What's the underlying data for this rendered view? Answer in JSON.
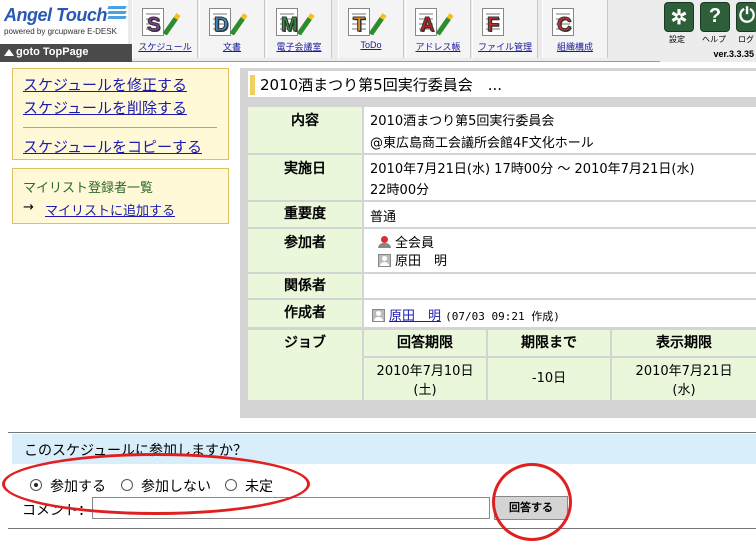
{
  "header": {
    "logo": "Angel Touch",
    "logo_sub": "powered by grcupware E-DESK",
    "goto_prefix": "goto",
    "goto_page": "TopPage",
    "nav": [
      {
        "label": "スケジュール",
        "letter": "S",
        "color": "#8a3aa8"
      },
      {
        "label": "文書",
        "letter": "D",
        "color": "#3a8ac0"
      },
      {
        "label": "電子会議室",
        "letter": "M",
        "color": "#2a9a3a"
      },
      {
        "label": "ToDo",
        "letter": "T",
        "color": "#e89020"
      },
      {
        "label": "アドレス帳",
        "letter": "A",
        "color": "#c02020"
      },
      {
        "label": "ファイル管理",
        "letter": "F",
        "color": "#c03030"
      },
      {
        "label": "組織構成",
        "letter": "C",
        "color": "#c03030"
      }
    ],
    "tools": {
      "settings": "設定",
      "help": "ヘルプ",
      "logout": "ログ"
    },
    "version": "ver.3.3.35"
  },
  "menu": {
    "edit": "スケジュールを修正する",
    "delete": "スケジュールを削除する",
    "copy": "スケジュールをコピーする",
    "mylist_title": "マイリスト登録者一覧",
    "mylist_arrow": "→",
    "mylist_add": "マイリストに追加する"
  },
  "schedule": {
    "title": "2010酒まつり第5回実行委員会　...",
    "labels": {
      "content": "内容",
      "datetime": "実施日",
      "importance": "重要度",
      "participants": "参加者",
      "related": "関係者",
      "creator": "作成者",
      "job": "ジョブ"
    },
    "content_line1": "2010酒まつり第5回実行委員会",
    "content_line2": "@東広島商工会議所会館4F文化ホール",
    "datetime_line1": "2010年7月21日(水) 17時00分 ～ 2010年7月21日(水)",
    "datetime_line2": "22時00分",
    "importance": "普通",
    "participant_group": "全会員",
    "participant_user": "原田　明",
    "related": "",
    "creator_name": "原田　明",
    "creator_meta": "(07/03 09:21 作成)",
    "job_headers": [
      "回答期限",
      "期限まで",
      "表示期限"
    ],
    "job_answer_deadline_1": "2010年7月10日",
    "job_answer_deadline_2": "(土)",
    "job_remaining": "-10日",
    "job_display_deadline_1": "2010年7月21日",
    "job_display_deadline_2": "(水)"
  },
  "response": {
    "question": "このスケジュールに参加しますか？",
    "options": [
      "参加する",
      "参加しない",
      "未定"
    ],
    "selected": "参加する",
    "comment_label": "コメント：",
    "comment_value": "",
    "submit": "回答する"
  },
  "annotation_color": "#e02020"
}
